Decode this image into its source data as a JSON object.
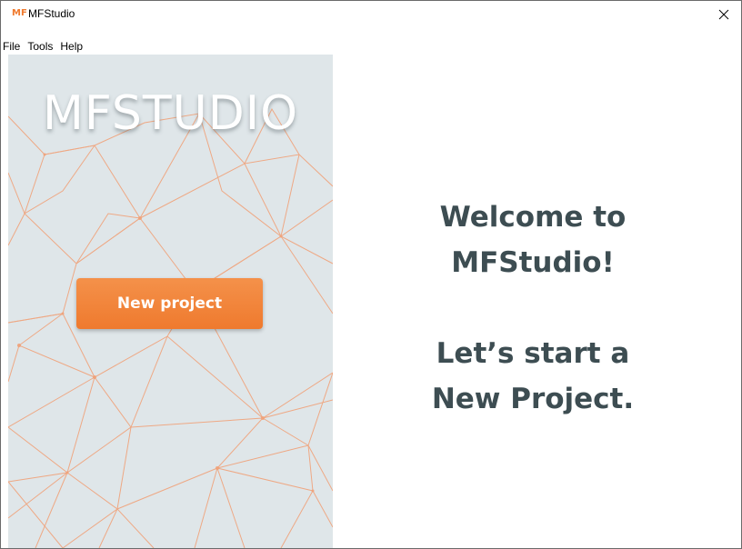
{
  "window": {
    "logo_text": "MF",
    "title": "MFStudio",
    "close_symbol": "✕"
  },
  "menu": {
    "items": [
      "File",
      "Tools",
      "Help"
    ]
  },
  "side_panel": {
    "brand": "MFSTUDIO",
    "new_project_label": "New project",
    "background_color": "#dfe6e9",
    "line_color": "#f0a27a"
  },
  "main": {
    "welcome_line1": "Welcome to",
    "welcome_line2": "MFStudio!",
    "start_line1": "Let’s start a",
    "start_line2": "New Project."
  },
  "colors": {
    "accent": "#ef7a2e",
    "heading_text": "#3d4d52"
  }
}
